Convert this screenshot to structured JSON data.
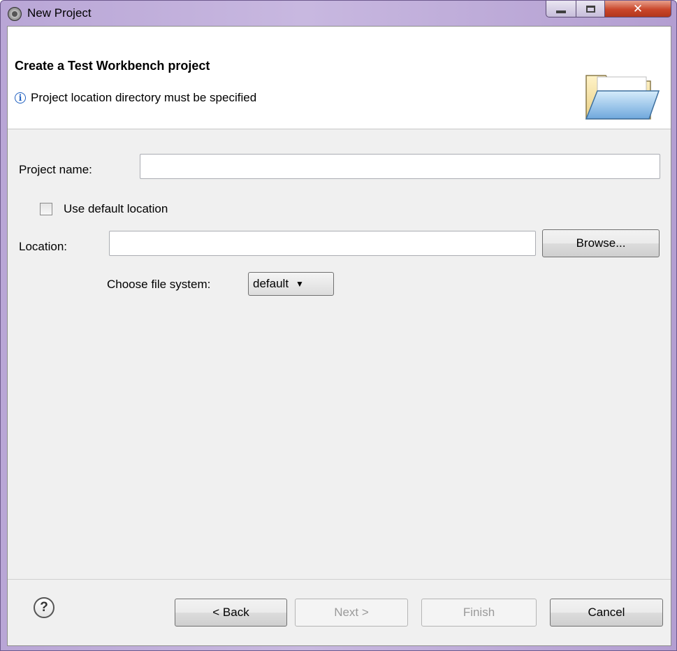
{
  "window": {
    "title": "New Project",
    "close_glyph": "✕"
  },
  "header": {
    "title": "Create a Test Workbench project",
    "info_glyph": "i",
    "message": "Project location directory must be specified",
    "icon": "folder-icon"
  },
  "form": {
    "project_name_label": "Project name:",
    "project_name_value": "",
    "use_default_label": "Use default location",
    "use_default_checked": false,
    "location_label": "Location:",
    "location_value": "",
    "browse_label": "Browse...",
    "file_system_label": "Choose file system:",
    "file_system_value": "default"
  },
  "footer": {
    "help_glyph": "?",
    "back_label": "< Back",
    "next_label": "Next >",
    "finish_label": "Finish",
    "cancel_label": "Cancel"
  },
  "colors": {
    "titlebar": "#b9a6d6",
    "close_button": "#c9462a",
    "info": "#2060c0"
  }
}
